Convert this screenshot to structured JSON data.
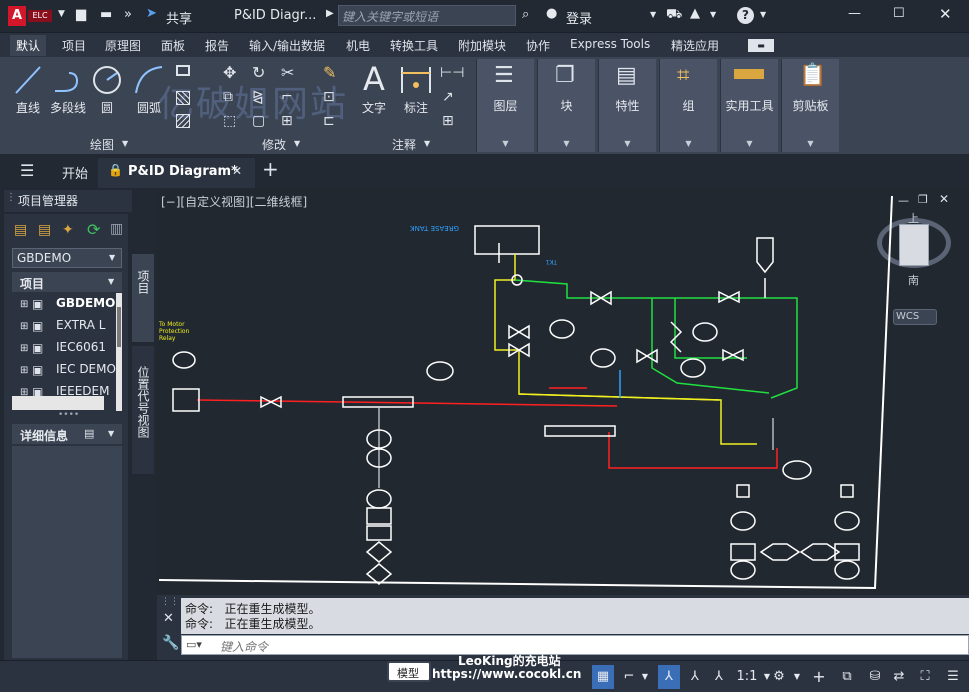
{
  "titlebar": {
    "logo_letter": "A",
    "logo_sub": "ELC",
    "share_label": "共享",
    "doc_title": "P&ID Diagr...",
    "search_placeholder": "键入关键字或短语",
    "login_label": "登录",
    "help_label": "?"
  },
  "menu_tabs": [
    "默认",
    "项目",
    "原理图",
    "面板",
    "报告",
    "输入/输出数据",
    "机电",
    "转换工具",
    "附加模块",
    "协作",
    "Express Tools",
    "精选应用"
  ],
  "ribbon": {
    "draw_tools": [
      "直线",
      "多段线",
      "圆",
      "圆弧"
    ],
    "draw_group": "绘图",
    "modify_group": "修改",
    "annotation_tools": [
      "文字",
      "标注"
    ],
    "annotation_group": "注释",
    "panels": [
      "图层",
      "块",
      "特性",
      "组",
      "实用工具",
      "剪贴板"
    ]
  },
  "watermark": "亿破姐网站",
  "doc_tabs": {
    "start": "开始",
    "active": "P&ID Diagram*",
    "add": "+"
  },
  "project_manager": {
    "title": "项目管理器",
    "project_select": "GBDEMO",
    "project_header": "项目",
    "items": [
      "GBDEMO",
      "EXTRA L",
      "IEC6061",
      "IEC DEMO",
      "IEEEDEM"
    ],
    "details_label": "详细信息",
    "side_tab_1": "项目",
    "side_tab_2": "位置代号视图"
  },
  "viewport": {
    "label": "[−][自定义视图][二维线框]",
    "viewcube_top": "上",
    "viewcube_side": "南",
    "wcs_label": "WCS"
  },
  "command": {
    "lines": [
      "命令:   正在重生成模型。",
      "命令:   正在重生成模型。"
    ],
    "input_placeholder": "键入命令"
  },
  "status": {
    "model_label": "模型",
    "overlay_line1": "LeoKing的充电站",
    "overlay_line2": "https://www.cocokl.cn",
    "scale": "1:1"
  },
  "colors": {
    "accent_blue": "#3a6fb8",
    "pipe_red": "#ff2020",
    "pipe_yellow": "#f0f020",
    "pipe_green": "#20e040",
    "equip_white": "#ffffff"
  }
}
